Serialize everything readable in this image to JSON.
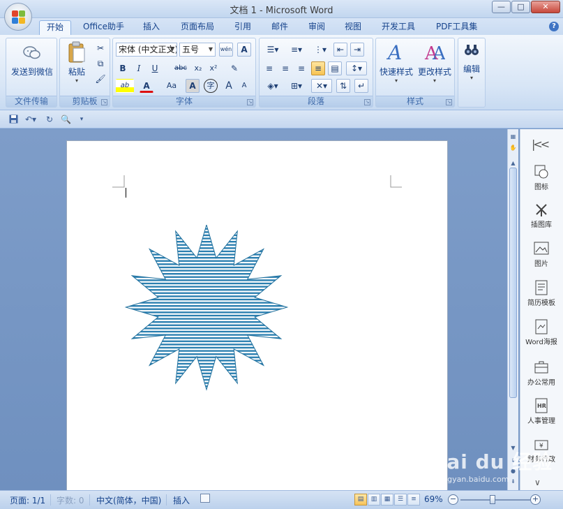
{
  "window": {
    "title": "文档 1 - Microsoft Word",
    "controls": {
      "minimize": "—",
      "maximize": "□",
      "close": "✕"
    }
  },
  "tabs": [
    {
      "label": "开始",
      "active": true
    },
    {
      "label": "Office助手"
    },
    {
      "label": "插入"
    },
    {
      "label": "页面布局"
    },
    {
      "label": "引用"
    },
    {
      "label": "邮件"
    },
    {
      "label": "审阅"
    },
    {
      "label": "视图"
    },
    {
      "label": "开发工具"
    },
    {
      "label": "PDF工具集"
    }
  ],
  "help_label": "?",
  "ribbon": {
    "groups": {
      "file_transfer": {
        "label": "文件传输",
        "send_label": "发送到微信"
      },
      "clipboard": {
        "label": "剪贴板",
        "paste_label": "粘贴"
      },
      "font": {
        "label": "字体",
        "font_name": "宋体 (中文正文)",
        "font_size": "五号",
        "bold": "B",
        "italic": "I",
        "underline": "U",
        "strike": "abc",
        "subscript": "x₂",
        "superscript": "x²",
        "case": "Aa",
        "grow": "A",
        "shrink": "A",
        "font_color": "A",
        "highlight": "ab",
        "char_border": "A",
        "enclose": "字",
        "phonetic": "wén",
        "clear": "A"
      },
      "paragraph": {
        "label": "段落"
      },
      "styles": {
        "label": "样式",
        "quick_styles": "快速样式",
        "change_styles": "更改样式"
      },
      "editing": {
        "edit_label": "编辑"
      }
    }
  },
  "sidepanel": {
    "items": [
      {
        "label": "图标"
      },
      {
        "label": "插图库"
      },
      {
        "label": "图片"
      },
      {
        "label": "简历模板"
      },
      {
        "label": "Word海报"
      },
      {
        "label": "办公常用"
      },
      {
        "label": "人事管理"
      },
      {
        "label": "财务行政"
      }
    ]
  },
  "status": {
    "page": "页面: 1/1",
    "words": "字数: 0",
    "language": "中文(简体，中国)",
    "mode": "插入",
    "zoom": "69%",
    "zoom_fraction": 0.46
  },
  "watermark": {
    "brand": "Bai du 经验",
    "url": "jingyan.baidu.com"
  },
  "colors": {
    "shape_stroke": "#1f6f9c",
    "shape_stripe": "#2b7fb0",
    "shadow": "#9a9a9a",
    "accent": "#15428b"
  }
}
